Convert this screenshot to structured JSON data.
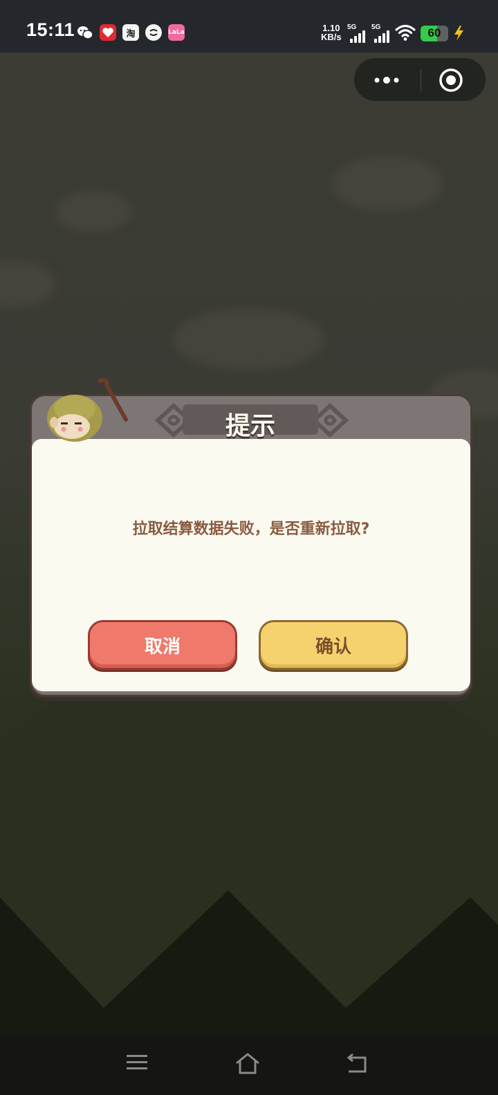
{
  "status_bar": {
    "time": "15:11",
    "notification_icons": [
      "wechat-icon",
      "red-heart-app-icon",
      "taobao-icon",
      "round-app-icon",
      "pink-app-icon"
    ],
    "taobao_glyph": "淘",
    "pink_glyph": "LaLa",
    "net_speed_value": "1.10",
    "net_speed_unit": "KB/s",
    "signal_1_label": "5G",
    "signal_2_label": "5G",
    "battery_percent": "60",
    "battery_level": 0.6,
    "colors": {
      "battery_fill": "#36c94a",
      "charge": "#f2c21a"
    }
  },
  "dialog": {
    "title": "提示",
    "message": "拉取结算数据失败，是否重新拉取?",
    "cancel_label": "取消",
    "confirm_label": "确认",
    "colors": {
      "cancel": "#ef7a6b",
      "confirm": "#f6d26f",
      "body": "#fbfaf0",
      "message": "#8a5a40"
    }
  },
  "nav_bar": {
    "icons": [
      "menu-icon",
      "home-icon",
      "back-icon"
    ]
  }
}
